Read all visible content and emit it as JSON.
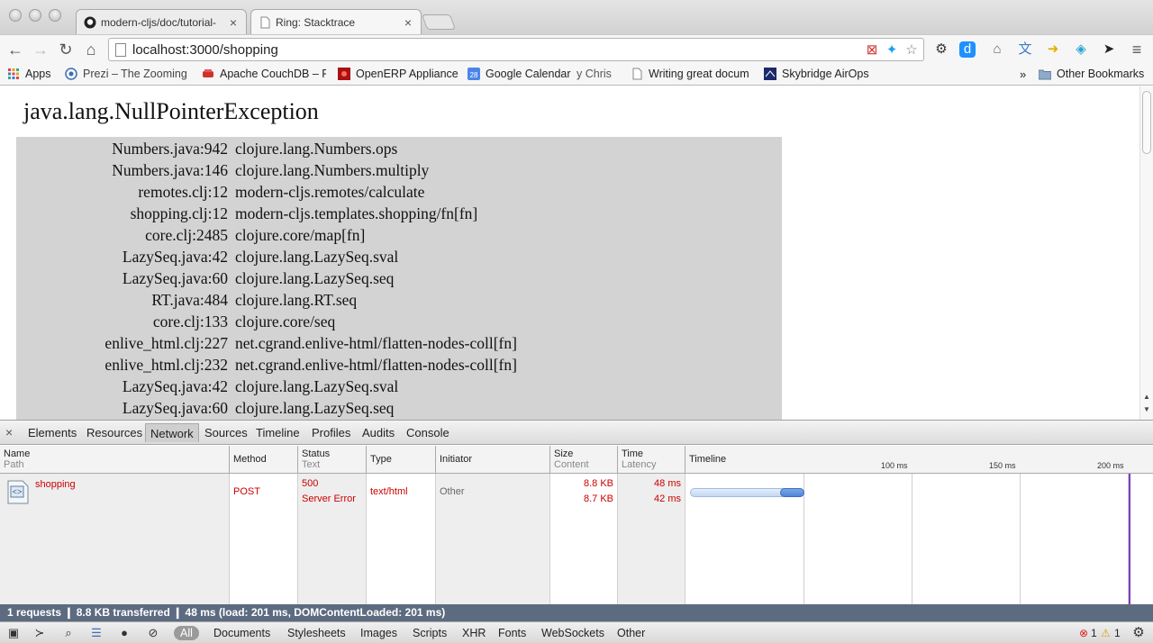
{
  "tabs": [
    {
      "title": "modern-cljs/doc/tutorial-",
      "icon": "github-icon",
      "active": false
    },
    {
      "title": "Ring: Stacktrace",
      "icon": "page-icon",
      "active": true
    }
  ],
  "address": {
    "url": "localhost:3000/shopping"
  },
  "bookmarks": {
    "items": [
      {
        "label": "Apps",
        "icon": "apps-grid-icon"
      },
      {
        "label": "Prezi – The Zooming",
        "icon": "prezi-icon"
      },
      {
        "label": "Apache CouchDB – F",
        "icon": "couchdb-icon"
      },
      {
        "label": "OpenERP Appliance",
        "icon": "openerp-icon"
      },
      {
        "label": "Google Calendar",
        "icon": "calendar-icon"
      },
      {
        "label": "y Chris",
        "icon": ""
      },
      {
        "label": "Writing great docum",
        "icon": "page-icon"
      },
      {
        "label": "Skybridge AirOps",
        "icon": "skybridge-icon"
      }
    ],
    "overflow": "»",
    "other": "Other Bookmarks"
  },
  "page": {
    "exception": "java.lang.NullPointerException",
    "trace": [
      {
        "src": "Numbers.java:942",
        "fn": "clojure.lang.Numbers.ops"
      },
      {
        "src": "Numbers.java:146",
        "fn": "clojure.lang.Numbers.multiply"
      },
      {
        "src": "remotes.clj:12",
        "fn": "modern-cljs.remotes/calculate"
      },
      {
        "src": "shopping.clj:12",
        "fn": "modern-cljs.templates.shopping/fn[fn]"
      },
      {
        "src": "core.clj:2485",
        "fn": "clojure.core/map[fn]"
      },
      {
        "src": "LazySeq.java:42",
        "fn": "clojure.lang.LazySeq.sval"
      },
      {
        "src": "LazySeq.java:60",
        "fn": "clojure.lang.LazySeq.seq"
      },
      {
        "src": "RT.java:484",
        "fn": "clojure.lang.RT.seq"
      },
      {
        "src": "core.clj:133",
        "fn": "clojure.core/seq"
      },
      {
        "src": "enlive_html.clj:227",
        "fn": "net.cgrand.enlive-html/flatten-nodes-coll[fn]"
      },
      {
        "src": "enlive_html.clj:232",
        "fn": "net.cgrand.enlive-html/flatten-nodes-coll[fn]"
      },
      {
        "src": "LazySeq.java:42",
        "fn": "clojure.lang.LazySeq.sval"
      },
      {
        "src": "LazySeq.java:60",
        "fn": "clojure.lang.LazySeq.seq"
      },
      {
        "src": "",
        "fn": ""
      }
    ]
  },
  "devtools": {
    "close": "×",
    "tabs": [
      "Elements",
      "Resources",
      "Network",
      "Sources",
      "Timeline",
      "Profiles",
      "Audits",
      "Console"
    ],
    "active_tab": "Network",
    "columns": {
      "name": "Name",
      "path": "Path",
      "method": "Method",
      "status": "Status",
      "text": "Text",
      "type": "Type",
      "initiator": "Initiator",
      "size": "Size",
      "content": "Content",
      "time": "Time",
      "latency": "Latency",
      "timeline": "Timeline",
      "ticks": [
        "100 ms",
        "150 ms",
        "200 ms"
      ]
    },
    "request": {
      "name": "shopping",
      "method": "POST",
      "status": "500",
      "status_text": "Server Error",
      "type": "text/html",
      "initiator": "Other",
      "size": "8.8 KB",
      "content": "8.7 KB",
      "time": "48 ms",
      "latency": "42 ms"
    },
    "summary": "1 requests  ❙  8.8 KB transferred  ❙  48 ms (load: 201 ms, DOMContentLoaded: 201 ms)",
    "filters": [
      "All",
      "Documents",
      "Stylesheets",
      "Images",
      "Scripts",
      "XHR",
      "Fonts",
      "WebSockets",
      "Other"
    ],
    "errors": "1",
    "warnings": "1"
  }
}
